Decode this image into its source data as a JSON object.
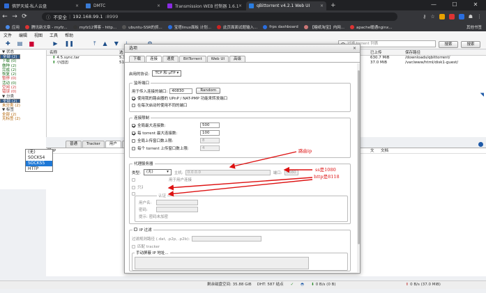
{
  "browser": {
    "tabs": [
      {
        "label": "佛梦天城-私人云盘",
        "color": "#2e6bd6"
      },
      {
        "label": "DMTC",
        "color": "#3a7bd5"
      },
      {
        "label": "Transmission WEB 控制器 1.6.1",
        "color": "#8a2be2"
      },
      {
        "label": "qBittorrent v4.2.1 Web UI",
        "color": "#2a7de1"
      }
    ],
    "new_tab": "+",
    "url": {
      "security": "不安全",
      "host": "192.168.99.1",
      "port": ":8999"
    },
    "bookmarks": [
      "应用",
      "腾讯新文章 - myfz...",
      "myfz12博客 - http...",
      "ubuntu-SSR的抓...",
      "宝塔linux面板 计划...",
      "此页面面试题输入...",
      "frps dashboard",
      "【糖纸淘宝】内网...",
      "apache暖通nginx..."
    ],
    "bookmarks_other": "其他书签"
  },
  "app": {
    "menu": [
      "文件",
      "编辑",
      "视图",
      "工具",
      "帮助"
    ],
    "search_placeholder": "过滤 torrent 列表",
    "search_btn": "搜索",
    "plugin_btn": "搜索",
    "sidebar": [
      {
        "label": "▼ 状态",
        "sel": false,
        "color": "#333"
      },
      {
        "label": "全部 (2)",
        "sel": true,
        "color": "#fff"
      },
      {
        "label": "下载 (0)",
        "sel": false,
        "color": "#1a6e1a"
      },
      {
        "label": "做种 (2)",
        "sel": false,
        "color": "#1a6e1a"
      },
      {
        "label": "完成 (2)",
        "sel": false,
        "color": "#1a6e1a"
      },
      {
        "label": "恢复 (2)",
        "sel": false,
        "color": "#1a6e1a"
      },
      {
        "label": "暂停 (0)",
        "sel": false,
        "color": "#c33"
      },
      {
        "label": "活动 (0)",
        "sel": false,
        "color": "#1a6e1a"
      },
      {
        "label": "空闲 (2)",
        "sel": false,
        "color": "#c33"
      },
      {
        "label": "错误 (0)",
        "sel": false,
        "color": "#c33"
      },
      {
        "label": "▼ 分类",
        "sel": false,
        "color": "#333"
      },
      {
        "label": "全部 (2)",
        "sel": true,
        "color": "#fff"
      },
      {
        "label": "未分类 (2)",
        "sel": false,
        "color": "#b06000"
      },
      {
        "label": "▼ 标签",
        "sel": false,
        "color": "#333"
      },
      {
        "label": "全部 (2)",
        "sel": false,
        "color": "#b06000"
      },
      {
        "label": "无标签 (2)",
        "sel": false,
        "color": "#b06000"
      }
    ],
    "list_headers": [
      "名称",
      "选"
    ],
    "list_headers_right": [
      "已上传",
      "保存路径"
    ],
    "rows": [
      {
        "name": "4.5.sync.tar",
        "size": "5.1",
        "up": "630.7 MiB",
        "path": "/downloads/qbittorrent/"
      },
      {
        "name": "小团团",
        "size": "51.",
        "up": "37.0 MiB",
        "path": "/var/www/html/disk1-guest/"
      }
    ],
    "props_tabs": [
      "普通",
      "Tracker",
      "用户",
      "HTTP 源"
    ],
    "peers_headers": [
      "国 IP"
    ],
    "peers_headers_right": [
      "文",
      "文档"
    ],
    "status": {
      "disk": "剩余磁盘空间: 35.88 GiB",
      "dht": "DHT: 587 结点",
      "down": "0 B/s (0 B)",
      "up": "0 B/s (37.0 MiB)"
    }
  },
  "dialog": {
    "title": "选项",
    "close": "×",
    "tabs": [
      "下载",
      "连接",
      "速度",
      "BitTorrent",
      "Web UI",
      "高级"
    ],
    "active_tab": 1,
    "protocol_label": "启用的协议:",
    "protocol_value": "TCP 和 μTP",
    "listen": {
      "legend": "监听端口",
      "port_label": "用于传入连接的端口:",
      "port_value": "40830",
      "random_btn": "Random",
      "upnp": "使用我的路由器的 UPnP / NAT-PMP 功能来转发端口",
      "random_start": "在每次启动时使用不同的端口"
    },
    "limits": {
      "legend": "连接限制",
      "global_max": "全局最大连接数:",
      "global_max_val": "500",
      "per_torrent": "每 torrent 最大连接数:",
      "per_torrent_val": "100",
      "global_upload": "全局上传窗口数上限:",
      "global_upload_val": "8",
      "per_upload": "每个 torrent 上传窗口数上限:",
      "per_upload_val": "4"
    },
    "proxy": {
      "legend": "代理服务器",
      "type_label": "类型:",
      "type_value": "(无)",
      "host_label": "主机:",
      "host_value": "0.0.0.0",
      "port_label": "端口:",
      "port_value": "8080",
      "options": [
        "(无)",
        "SOCKS4",
        "SOCKS5",
        "HTTP"
      ],
      "highlight": 2,
      "peer_conn": "用于用户连接",
      "only_torrents": "只对 torrent 使用代理",
      "auth_label": "认证",
      "user_label": "用户名:",
      "pass_label": "密码:",
      "hint": "提示: 密码未加密"
    },
    "ipfilter": {
      "legend": "IP 过滤",
      "path_label": "过滤规则路径 (.dat, .p2p, .p2b):",
      "tracker": "匹配 tracker",
      "manual": "手动屏蔽 IP 地址..."
    }
  },
  "annotations": {
    "router_ip": "路由ip",
    "ss_port": "ss是1080",
    "http_port": "http是8118",
    "color": "#dd1111"
  }
}
